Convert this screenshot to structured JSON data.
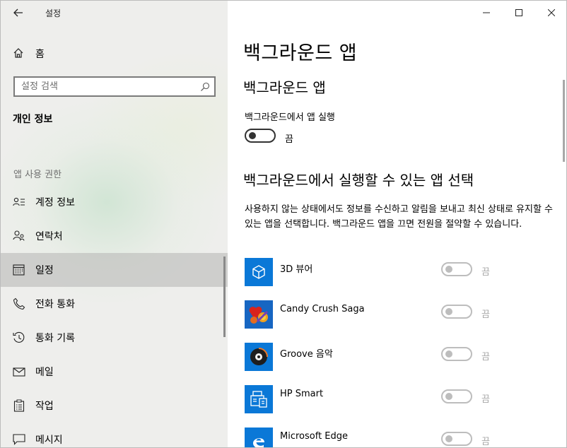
{
  "window": {
    "title": "설정"
  },
  "sidebar": {
    "home_label": "홈",
    "search": {
      "placeholder": "설정 검색"
    },
    "section_title": "개인 정보",
    "group_title": "앱 사용 권한",
    "items": [
      {
        "label": "계정 정보",
        "icon": "account-info-icon"
      },
      {
        "label": "연락처",
        "icon": "contacts-icon"
      },
      {
        "label": "일정",
        "icon": "calendar-icon",
        "selected": true
      },
      {
        "label": "전화 통화",
        "icon": "phone-icon"
      },
      {
        "label": "통화 기록",
        "icon": "call-history-icon"
      },
      {
        "label": "메일",
        "icon": "mail-icon"
      },
      {
        "label": "작업",
        "icon": "tasks-icon"
      },
      {
        "label": "메시지",
        "icon": "message-icon"
      }
    ]
  },
  "content": {
    "page_title": "백그라운드 앱",
    "section1_title": "백그라운드 앱",
    "run_in_background_label": "백그라운드에서 앱 실행",
    "run_in_background_state": "끔",
    "section2_title": "백그라운드에서 실행할 수 있는 앱 선택",
    "description": "사용하지 않는 상태에서도 정보를 수신하고 알림을 보내고 최신 상태로 유지할 수 있는 앱을 선택합니다. 백그라운드 앱을 끄면 전원을 절약할 수 있습니다.",
    "apps": [
      {
        "name": "3D 뷰어",
        "state": "끔",
        "icon": "3d-viewer-icon",
        "color": "#0a78d7"
      },
      {
        "name": "Candy Crush Saga",
        "state": "끔",
        "icon": "candy-crush-icon",
        "color": "#1766c2"
      },
      {
        "name": "Groove 음악",
        "state": "끔",
        "icon": "groove-music-icon",
        "color": "#0a78d7"
      },
      {
        "name": "HP Smart",
        "state": "끔",
        "icon": "hp-smart-icon",
        "color": "#0a78d7"
      },
      {
        "name": "Microsoft Edge",
        "state": "끔",
        "icon": "edge-icon",
        "color": "#0a78d7"
      }
    ]
  },
  "colors": {
    "accent": "#0a78d7",
    "sidebar_bg": "#eeeeec",
    "selected_bg": "#c6c6c4",
    "disabled": "#bdbdbd"
  }
}
